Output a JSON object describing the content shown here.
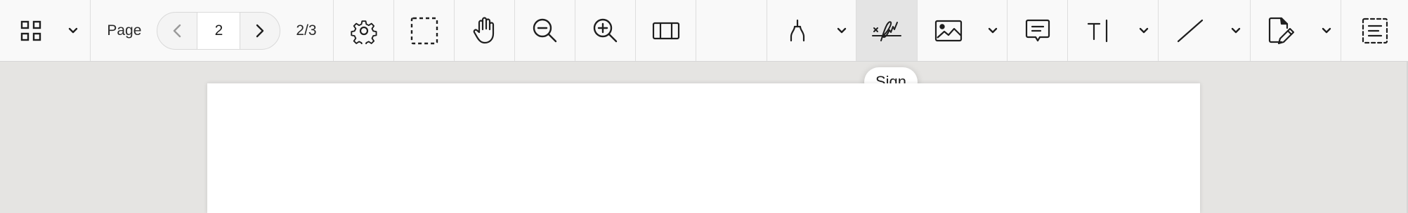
{
  "toolbar": {
    "page_label": "Page",
    "page_input_value": "2",
    "page_count": "2/3",
    "icons": {
      "thumbnails": "grid-icon",
      "thumbnails_menu": "chevron-down-icon",
      "prev_page": "chevron-left-icon",
      "next_page": "chevron-right-icon",
      "settings": "gear-icon",
      "select": "marquee-select-icon",
      "pan": "hand-icon",
      "zoom_out": "zoom-out-icon",
      "zoom_in": "zoom-in-icon",
      "columns": "columns-icon",
      "highlight": "pen-nib-icon",
      "sign": "signature-icon",
      "image": "image-icon",
      "comment": "comment-icon",
      "text": "text-cursor-icon",
      "line": "line-icon",
      "edit": "document-edit-icon",
      "form": "form-fields-icon"
    },
    "active_tool": "sign"
  },
  "tooltip": {
    "text": "Sign"
  },
  "colors": {
    "toolbar_bg": "#f9f9f9",
    "workspace_bg": "#e5e4e2",
    "active_bg": "#e4e4e4",
    "icon": "#1f1f1f"
  }
}
